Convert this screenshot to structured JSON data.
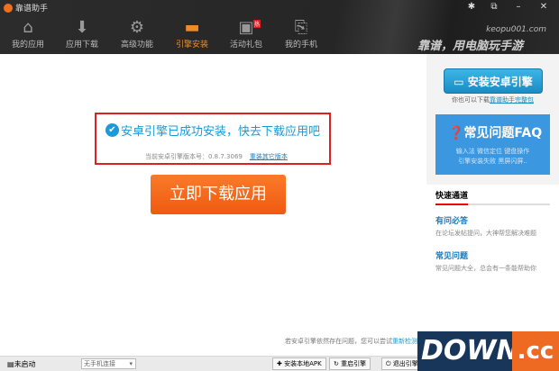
{
  "app": {
    "title": "靠谱助手",
    "site": "keopu001.com",
    "slogan": "靠谱，用电脑玩手游"
  },
  "window_controls": [
    "settings",
    "restore",
    "minimize",
    "close"
  ],
  "nav": [
    {
      "label": "我的应用",
      "icon": "home-icon"
    },
    {
      "label": "应用下载",
      "icon": "download-box-icon"
    },
    {
      "label": "高级功能",
      "icon": "gears-icon"
    },
    {
      "label": "引擎安装",
      "icon": "drive-icon",
      "active": true
    },
    {
      "label": "活动礼包",
      "icon": "gift-icon",
      "badge": "热"
    },
    {
      "label": "我的手机",
      "icon": "exit-phone-icon"
    }
  ],
  "main": {
    "success": "安卓引擎已成功安装，快去下载应用吧",
    "version_label": "当前安卓引擎版本号：0.8.7.3069",
    "reinstall_link": "重装其它版本",
    "download_button": "立即下载应用",
    "hint": "若安卓引擎依然存在问题，您可以尝试",
    "hint_link": "重新检测"
  },
  "sidebar": {
    "install_button": "安装安卓引擎",
    "also_text": "你也可以下载",
    "also_link": "靠谱助手完整包",
    "faq_title": "常见问题FAQ",
    "faq_line1": "输入法  微信定位  键盘操作",
    "faq_line2": "引擎安装失败  黑屏闪屏..",
    "quick_title": "快速通道",
    "links": [
      {
        "title": "有问必答",
        "desc": "在论坛发帖提问，大神帮您解决难题"
      },
      {
        "title": "常见问题",
        "desc": "常见问题大全，总会有一条能帮助你"
      }
    ]
  },
  "status": {
    "engine": "未启动",
    "phone_select": "无手机连接",
    "install_apk": "安装本地APK",
    "restart": "重启引擎",
    "exit": "退出引擎"
  },
  "watermark": {
    "left": "DOWN",
    "right": ".cc"
  },
  "colors": {
    "accent": "#f08a24",
    "link": "#1a9ad8",
    "highlight_box": "#e02020"
  }
}
